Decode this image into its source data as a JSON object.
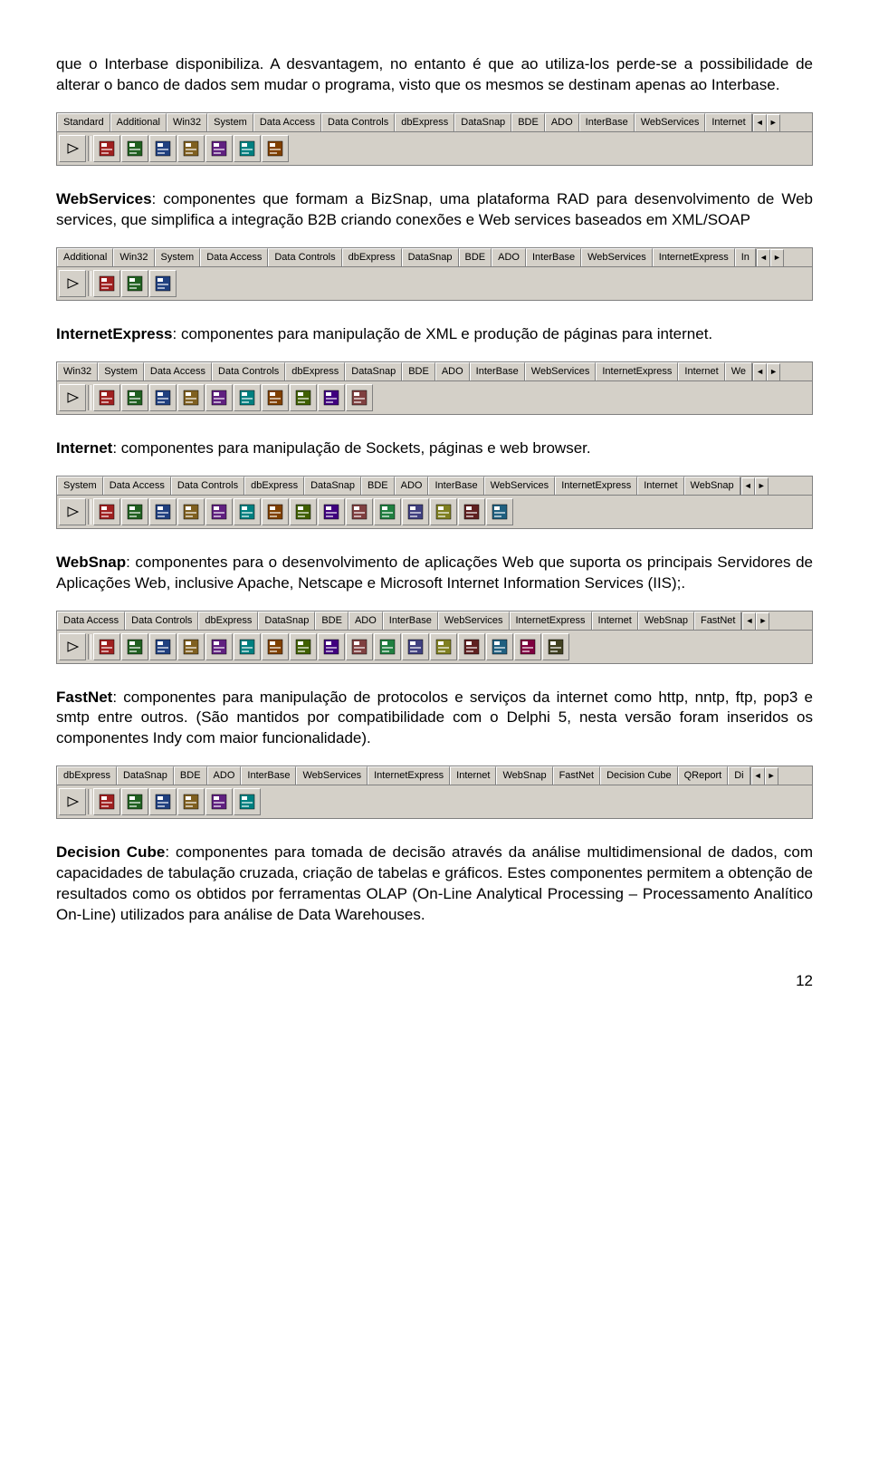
{
  "paragraphs": {
    "intro": "que o Interbase disponibiliza. A desvantagem, no entanto é que ao utiliza-los perde-se a possibilidade de alterar o banco de dados sem mudar o programa, visto que os mesmos se destinam apenas ao Interbase.",
    "webservices_label": "WebServices",
    "webservices_text": ": componentes que formam a BizSnap, uma plataforma RAD para desenvolvimento de Web services, que simplifica a integração B2B criando conexões e Web services baseados em XML/SOAP",
    "internetexpress_label": "InternetExpress",
    "internetexpress_text": ": componentes para manipulação de XML e produção de páginas para internet.",
    "internet_label": "Internet",
    "internet_text": ": componentes para manipulação de Sockets, páginas e web browser.",
    "websnap_label": "WebSnap",
    "websnap_text": ": componentes para o desenvolvimento de aplicações Web que suporta os principais Servidores de Aplicações Web, inclusive Apache, Netscape e Microsoft Internet Information Services (IIS);.",
    "fastnet_label": "FastNet",
    "fastnet_text": ": componentes para manipulação de protocolos e serviços da internet como http, nntp, ftp, pop3 e smtp entre outros. (São mantidos por compatibilidade com o Delphi 5, nesta versão foram inseridos os componentes Indy com maior funcionalidade).",
    "decisioncube_label": "Decision Cube",
    "decisioncube_text": ": componentes para tomada de decisão através da análise multidimensional de dados, com capacidades de tabulação cruzada, criação de tabelas e gráficos. Estes componentes permitem a obtenção de resultados como os obtidos por ferramentas OLAP (On-Line Analytical Processing – Processamento Analítico On-Line) utilizados para análise de Data Warehouses."
  },
  "palettes": {
    "p1": {
      "tabs": [
        "Standard",
        "Additional",
        "Win32",
        "System",
        "Data Access",
        "Data Controls",
        "dbExpress",
        "DataSnap",
        "BDE",
        "ADO",
        "InterBase",
        "WebServices",
        "Internet"
      ],
      "active": 11,
      "icon_count": 7
    },
    "p2": {
      "tabs": [
        "Additional",
        "Win32",
        "System",
        "Data Access",
        "Data Controls",
        "dbExpress",
        "DataSnap",
        "BDE",
        "ADO",
        "InterBase",
        "WebServices",
        "InternetExpress",
        "In"
      ],
      "active": 11,
      "icon_count": 3
    },
    "p3": {
      "tabs": [
        "Win32",
        "System",
        "Data Access",
        "Data Controls",
        "dbExpress",
        "DataSnap",
        "BDE",
        "ADO",
        "InterBase",
        "WebServices",
        "InternetExpress",
        "Internet",
        "We"
      ],
      "active": 11,
      "icon_count": 10
    },
    "p4": {
      "tabs": [
        "System",
        "Data Access",
        "Data Controls",
        "dbExpress",
        "DataSnap",
        "BDE",
        "ADO",
        "InterBase",
        "WebServices",
        "InternetExpress",
        "Internet",
        "WebSnap"
      ],
      "active": 11,
      "icon_count": 15
    },
    "p5": {
      "tabs": [
        "Data Access",
        "Data Controls",
        "dbExpress",
        "DataSnap",
        "BDE",
        "ADO",
        "InterBase",
        "WebServices",
        "InternetExpress",
        "Internet",
        "WebSnap",
        "FastNet"
      ],
      "active": 11,
      "icon_count": 17
    },
    "p6": {
      "tabs": [
        "dbExpress",
        "DataSnap",
        "BDE",
        "ADO",
        "InterBase",
        "WebServices",
        "InternetExpress",
        "Internet",
        "WebSnap",
        "FastNet",
        "Decision Cube",
        "QReport",
        "Di"
      ],
      "active": 10,
      "icon_count": 6
    }
  },
  "page_number": "12",
  "scroll": {
    "left": "◄",
    "right": "►"
  },
  "icon_colors": [
    "#a02020",
    "#206020",
    "#204080",
    "#806020",
    "#602080",
    "#008080",
    "#804000",
    "#406000",
    "#400080",
    "#804040",
    "#208040",
    "#404080",
    "#808020",
    "#602020",
    "#206080",
    "#800040",
    "#404020"
  ]
}
